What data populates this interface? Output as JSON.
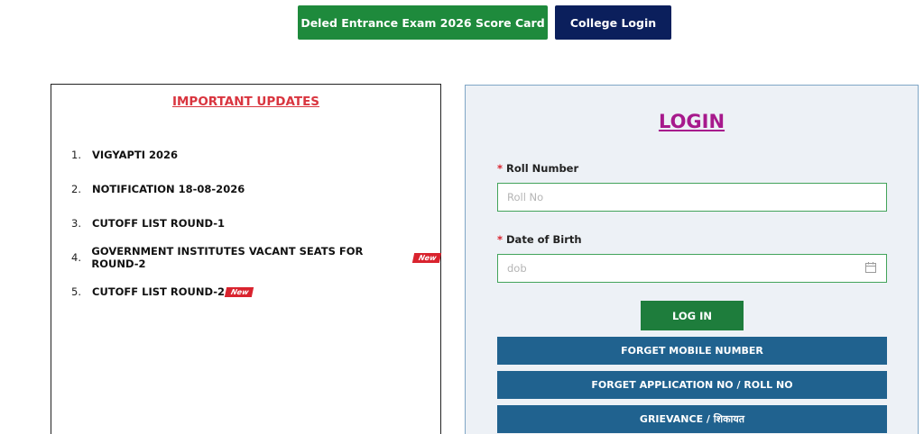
{
  "header": {
    "score_card_label": "Deled Entrance Exam 2026 Score Card",
    "college_login_label": "College Login"
  },
  "updates": {
    "title": "IMPORTANT UPDATES",
    "new_badge": "New",
    "items": [
      {
        "num": "1.",
        "label": "VIGYAPTI 2026"
      },
      {
        "num": "2.",
        "label": "NOTIFICATION 18-08-2026"
      },
      {
        "num": "3.",
        "label": "CUTOFF LIST ROUND-1"
      },
      {
        "num": "4.",
        "label": "GOVERNMENT INSTITUTES VACANT SEATS FOR ROUND-2"
      },
      {
        "num": "5.",
        "label": "CUTOFF LIST ROUND-2"
      }
    ]
  },
  "login": {
    "title": "LOGIN",
    "required_mark": "*",
    "roll_label": "Roll Number",
    "roll_placeholder": "Roll No",
    "dob_label": "Date of Birth",
    "dob_placeholder": "dob",
    "submit_label": "LOG IN",
    "forget_mobile_label": "FORGET MOBILE NUMBER",
    "forget_application_label": "FORGET APPLICATION NO / ROLL NO",
    "grievance_label": "GRIEVANCE / शिकायत"
  },
  "colors": {
    "score_card_button": "#1e8a3c",
    "college_login_button": "#0b1f5c",
    "updates_title": "#d9353f",
    "login_title": "#a7198c",
    "login_button": "#1e7d3c",
    "action_button": "#20628f",
    "new_badge": "#d9232e"
  },
  "icons": {
    "dob_calendar": "calendar-icon"
  }
}
